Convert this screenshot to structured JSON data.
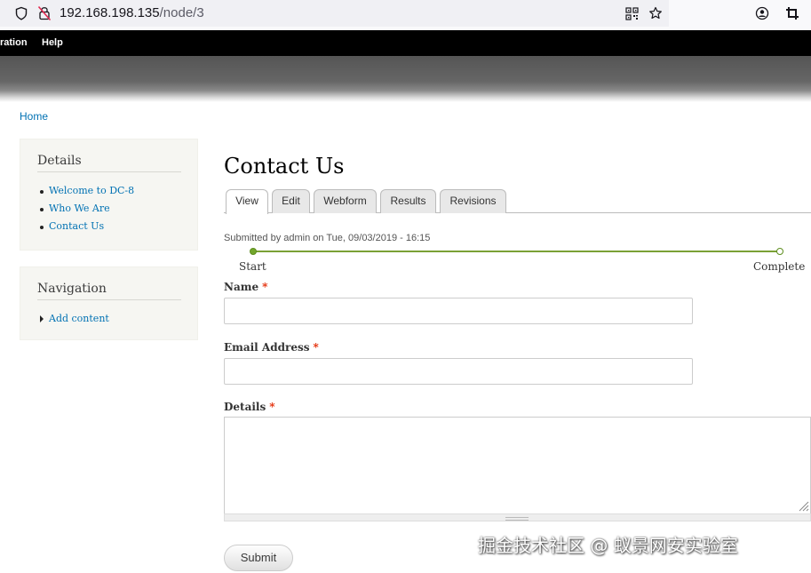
{
  "browser": {
    "url_host": "192.168.198.135",
    "url_path": "/node/3"
  },
  "admin_toolbar": {
    "items": [
      "ration",
      "Help"
    ]
  },
  "breadcrumb": {
    "home": "Home"
  },
  "sidebar": {
    "details": {
      "title": "Details",
      "links": [
        "Welcome to DC-8",
        "Who We Are",
        "Contact Us"
      ]
    },
    "navigation": {
      "title": "Navigation",
      "links": [
        "Add content"
      ]
    }
  },
  "main": {
    "title": "Contact Us",
    "tabs": [
      "View",
      "Edit",
      "Webform",
      "Results",
      "Revisions"
    ],
    "active_tab": "View",
    "submitted": "Submitted by admin on Tue, 09/03/2019 - 16:15",
    "progress": {
      "start_label": "Start",
      "end_label": "Complete",
      "value": 0
    }
  },
  "form": {
    "required_marker": "*",
    "fields": [
      {
        "label": "Name",
        "value": ""
      },
      {
        "label": "Email Address",
        "value": ""
      },
      {
        "label": "Details",
        "value": ""
      }
    ],
    "submit_label": "Submit"
  },
  "watermark": "掘金技术社区 @ 蚁景网安实验室",
  "colors": {
    "link": "#0071b3",
    "required": "#e32700",
    "progress": "#7aa136",
    "toolbar": "#000000"
  }
}
